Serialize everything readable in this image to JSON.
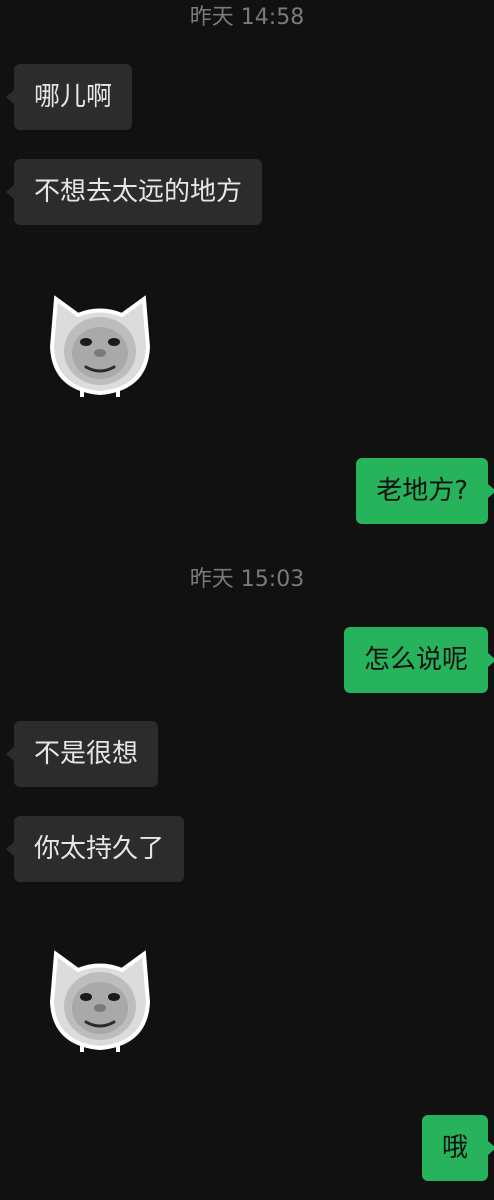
{
  "chat": {
    "timestamps": [
      "昨天 14:58",
      "昨天 15:03"
    ],
    "messages": [
      {
        "side": "left",
        "type": "text",
        "text": "哪儿啊"
      },
      {
        "side": "left",
        "type": "text",
        "text": "不想去太远的地方"
      },
      {
        "side": "left",
        "type": "sticker",
        "sticker": "cat-face-sticker"
      },
      {
        "side": "right",
        "type": "text",
        "text": "老地方?"
      },
      {
        "side": "right",
        "type": "text",
        "text": "怎么说呢"
      },
      {
        "side": "left",
        "type": "text",
        "text": "不是很想"
      },
      {
        "side": "left",
        "type": "text",
        "text": "你太持久了"
      },
      {
        "side": "left",
        "type": "sticker",
        "sticker": "cat-face-sticker"
      },
      {
        "side": "right",
        "type": "text",
        "text": "哦"
      }
    ]
  },
  "colors": {
    "background": "#111111",
    "incoming_bubble": "#2c2c2c",
    "outgoing_bubble": "#27b35c",
    "timestamp_text": "#7a7a7a"
  }
}
